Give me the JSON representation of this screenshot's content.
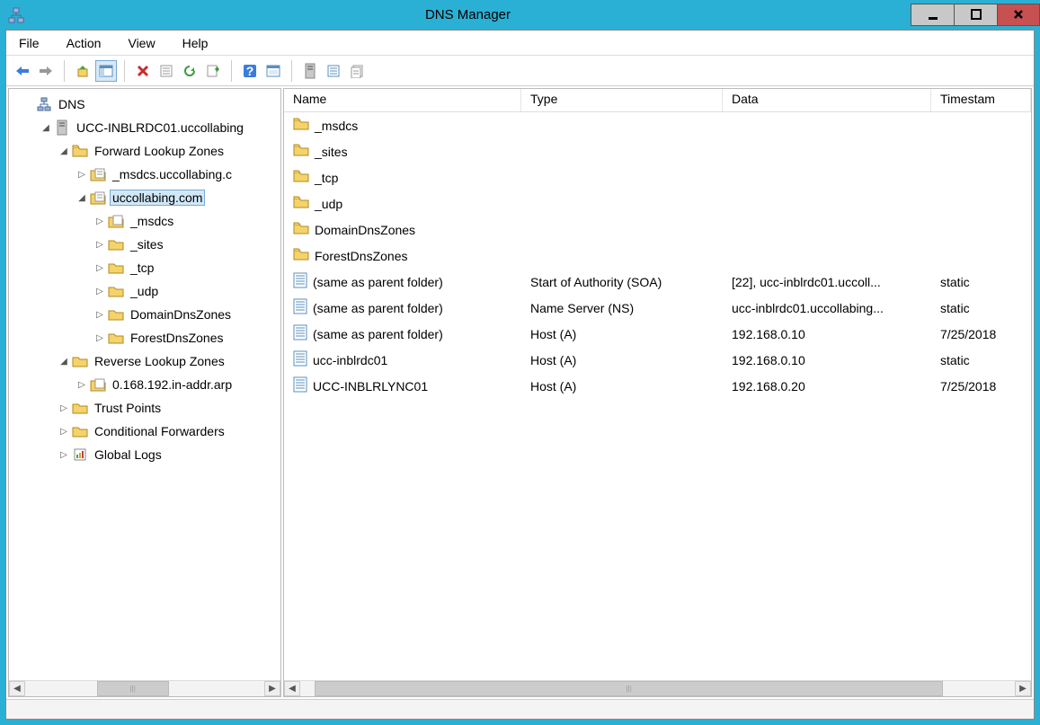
{
  "window": {
    "title": "DNS Manager"
  },
  "menu": {
    "file": "File",
    "action": "Action",
    "view": "View",
    "help": "Help"
  },
  "tree": {
    "root": "DNS",
    "server": "UCC-INBLRDC01.uccollabing",
    "fwd": "Forward Lookup Zones",
    "z_msdcs": "_msdcs.uccollabing.c",
    "z_main": "uccollabing.com",
    "sub_msdcs": "_msdcs",
    "sub_sites": "_sites",
    "sub_tcp": "_tcp",
    "sub_udp": "_udp",
    "sub_ddz": "DomainDnsZones",
    "sub_fdz": "ForestDnsZones",
    "rev": "Reverse Lookup Zones",
    "rev_zone": "0.168.192.in-addr.arp",
    "trust": "Trust Points",
    "cond": "Conditional Forwarders",
    "glog": "Global Logs"
  },
  "columns": {
    "name": "Name",
    "type": "Type",
    "data": "Data",
    "timestamp": "Timestam"
  },
  "records": [
    {
      "name": "_msdcs",
      "icon": "folder"
    },
    {
      "name": "_sites",
      "icon": "folder"
    },
    {
      "name": "_tcp",
      "icon": "folder"
    },
    {
      "name": "_udp",
      "icon": "folder"
    },
    {
      "name": "DomainDnsZones",
      "icon": "folder"
    },
    {
      "name": "ForestDnsZones",
      "icon": "folder"
    },
    {
      "name": "(same as parent folder)",
      "icon": "record",
      "type": "Start of Authority (SOA)",
      "data": "[22], ucc-inblrdc01.uccoll...",
      "ts": "static"
    },
    {
      "name": "(same as parent folder)",
      "icon": "record",
      "type": "Name Server (NS)",
      "data": "ucc-inblrdc01.uccollabing...",
      "ts": "static"
    },
    {
      "name": "(same as parent folder)",
      "icon": "record",
      "type": "Host (A)",
      "data": "192.168.0.10",
      "ts": "7/25/2018"
    },
    {
      "name": "ucc-inblrdc01",
      "icon": "record",
      "type": "Host (A)",
      "data": "192.168.0.10",
      "ts": "static"
    },
    {
      "name": "UCC-INBLRLYNC01",
      "icon": "record",
      "type": "Host (A)",
      "data": "192.168.0.20",
      "ts": "7/25/2018"
    }
  ]
}
